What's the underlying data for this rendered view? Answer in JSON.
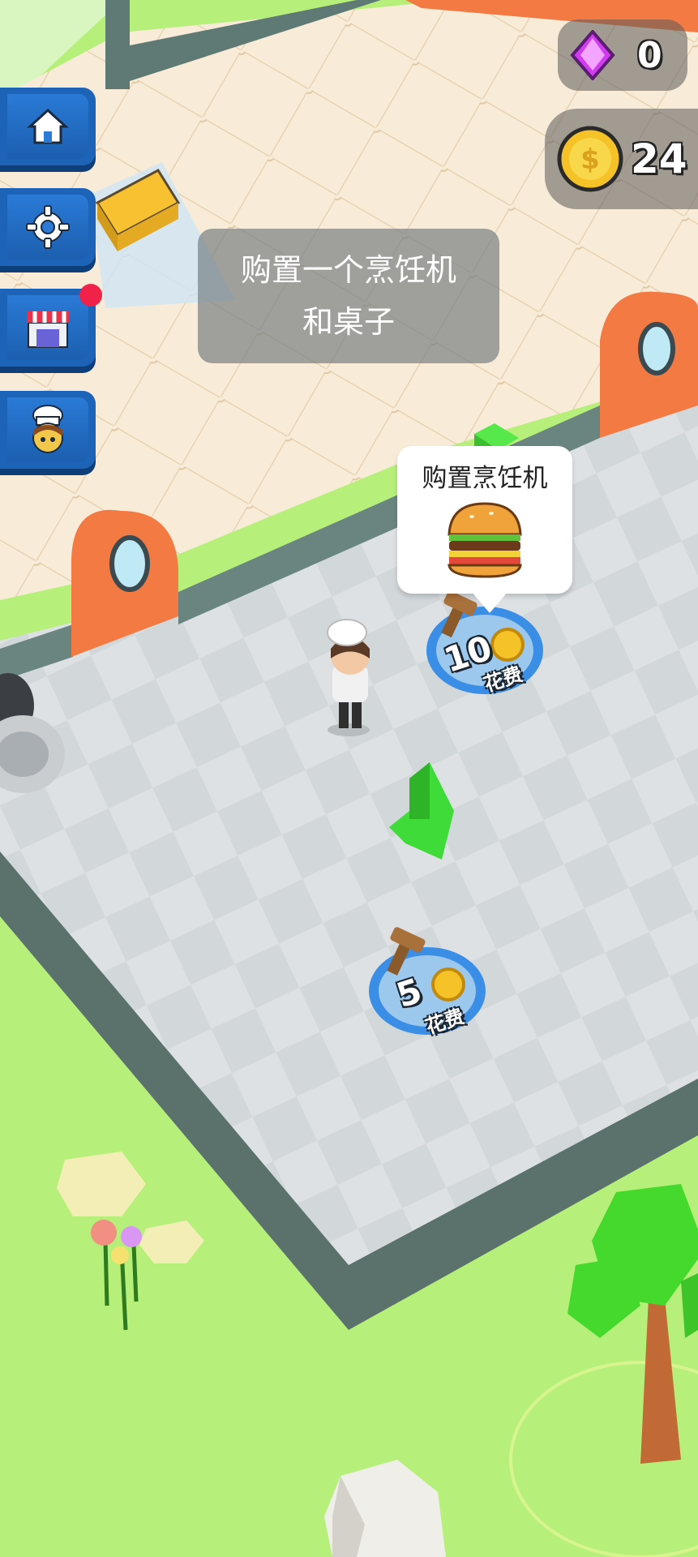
{
  "hud": {
    "gems": "0",
    "coins": "24"
  },
  "side_menu": [
    {
      "icon": "home-icon"
    },
    {
      "icon": "gear-icon"
    },
    {
      "icon": "shop-icon"
    },
    {
      "icon": "chef-icon"
    }
  ],
  "hint": {
    "line1": "购置一个烹饪机",
    "line2": "和桌子"
  },
  "purchase_bubble": {
    "title": "购置烹饪机",
    "icon": "burger-icon"
  },
  "buy_spots": [
    {
      "cost": "10",
      "label": "花费"
    },
    {
      "cost": "5",
      "label": "花费"
    }
  ],
  "colors": {
    "grass": "#b6f07a",
    "floor_light": "#f7ead6",
    "floor_gray": "#dfe3e5",
    "wall": "#5f7a74",
    "door": "#f47a44",
    "button_blue": "#1d63b8",
    "spot_blue": "#3a8ee6"
  }
}
